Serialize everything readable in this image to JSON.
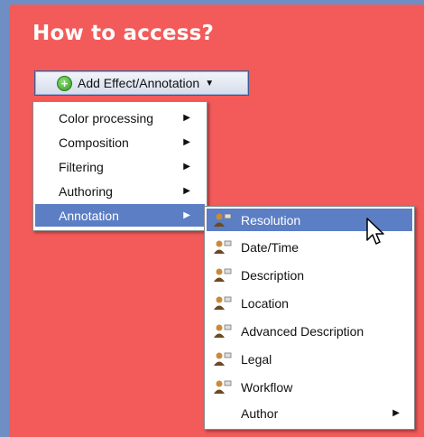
{
  "title": "How to access?",
  "dropdown": {
    "label": "Add Effect/Annotation",
    "icon": "plus-circle-icon",
    "caret": "▼"
  },
  "menu1": {
    "items": [
      {
        "label": "Color processing",
        "submenu": "▶",
        "selected": false
      },
      {
        "label": "Composition",
        "submenu": "▶",
        "selected": false
      },
      {
        "label": "Filtering",
        "submenu": "▶",
        "selected": false
      },
      {
        "label": "Authoring",
        "submenu": "▶",
        "selected": false
      },
      {
        "label": "Annotation",
        "submenu": "▶",
        "selected": true
      }
    ]
  },
  "menu2": {
    "items": [
      {
        "label": "Resolution",
        "icon": "person-annotation-icon",
        "selected": true
      },
      {
        "label": "Date/Time",
        "icon": "person-annotation-icon",
        "selected": false
      },
      {
        "label": "Description",
        "icon": "person-annotation-icon",
        "selected": false
      },
      {
        "label": "Location",
        "icon": "person-annotation-icon",
        "selected": false
      },
      {
        "label": "Advanced Description",
        "icon": "person-annotation-icon",
        "selected": false
      },
      {
        "label": "Legal",
        "icon": "person-annotation-icon",
        "selected": false
      },
      {
        "label": "Workflow",
        "icon": "person-annotation-icon",
        "selected": false
      },
      {
        "label": "Author",
        "submenu": "▶",
        "selected": false
      }
    ]
  },
  "colors": {
    "panel": "#f35a5a",
    "background": "#6f8fc4",
    "selection": "#5b7ec4"
  }
}
